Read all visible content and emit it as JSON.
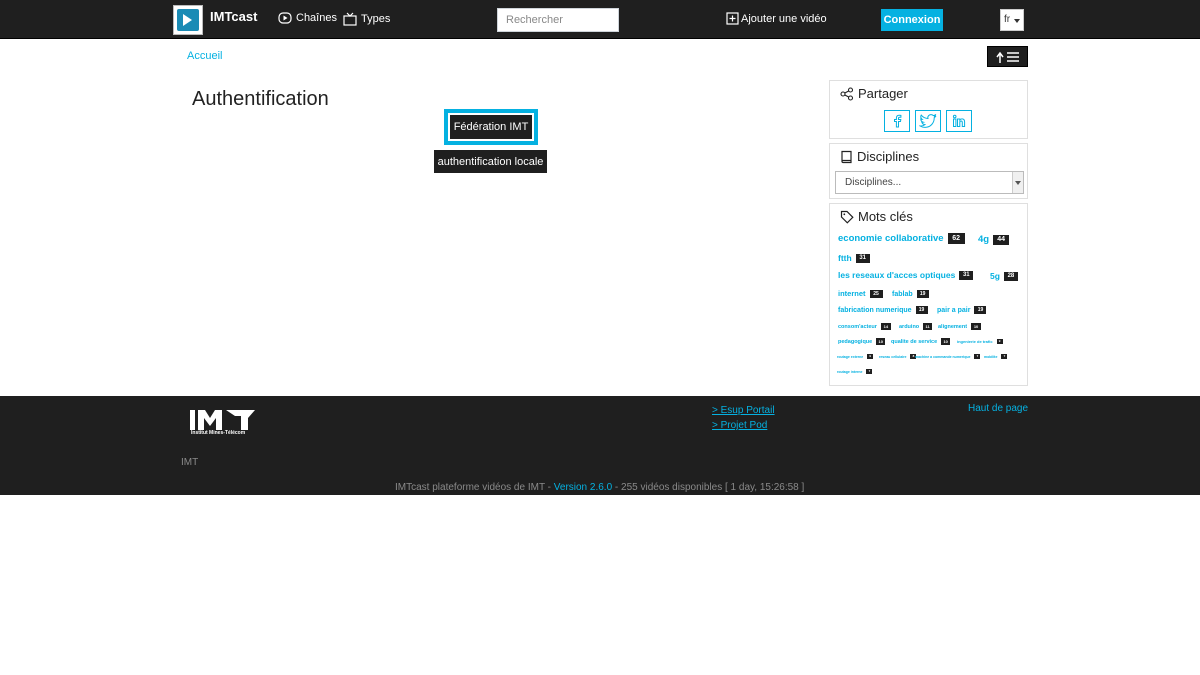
{
  "header": {
    "brand": "IMTcast",
    "nav_channels": "Chaînes",
    "nav_types": "Types",
    "search_placeholder": "Rechercher",
    "add_video": "Ajouter une vidéo",
    "login": "Connexion",
    "lang": "fr"
  },
  "breadcrumb": "Accueil",
  "main": {
    "title": "Authentification",
    "federation_button": "Fédération IMT",
    "local_button": "authentification locale"
  },
  "sidebar": {
    "share_title": "Partager",
    "share_icons": [
      "facebook-icon",
      "twitter-icon",
      "linkedin-icon"
    ],
    "disciplines_title": "Disciplines",
    "disciplines_selected": "Disciplines...",
    "tags_title": "Mots clés",
    "tags": [
      {
        "label": "economie collaborative",
        "count": "62"
      },
      {
        "label": "4g",
        "count": "44"
      },
      {
        "label": "ftth",
        "count": "31"
      },
      {
        "label": "les reseaux d'acces optiques",
        "count": "31"
      },
      {
        "label": "5g",
        "count": "28"
      },
      {
        "label": "internet",
        "count": "25"
      },
      {
        "label": "fablab",
        "count": "19"
      },
      {
        "label": "fabrication numerique",
        "count": "19"
      },
      {
        "label": "pair a pair",
        "count": "19"
      },
      {
        "label": "consom'acteur",
        "count": "14"
      },
      {
        "label": "arduino",
        "count": "11"
      },
      {
        "label": "alignement",
        "count": "10"
      },
      {
        "label": "pedagogique",
        "count": "10"
      },
      {
        "label": "qualite de service",
        "count": "10"
      },
      {
        "label": "ingenierie de trafic",
        "count": "9"
      },
      {
        "label": "routage externe",
        "count": "9"
      },
      {
        "label": "reseau cellulaire",
        "count": "8"
      },
      {
        "label": "machine a commande numerique",
        "count": "7"
      },
      {
        "label": "mobilite",
        "count": "7"
      },
      {
        "label": "routage interne",
        "count": "7"
      }
    ]
  },
  "footer": {
    "logo_subtitle": "Institut Mines-Télécom",
    "link_esup": "> Esup Portail",
    "link_pod": "> Projet Pod",
    "top_link": "Haut de page",
    "org": "IMT",
    "info_prefix": "IMTcast plateforme vidéos de IMT - ",
    "version": "Version 2.6.0",
    "info_suffix": " - 255 vidéos disponibles [ 1 day, 15:26:58 ]"
  },
  "colors": {
    "accent": "#05b1e1",
    "dark": "#1f1f1f"
  }
}
